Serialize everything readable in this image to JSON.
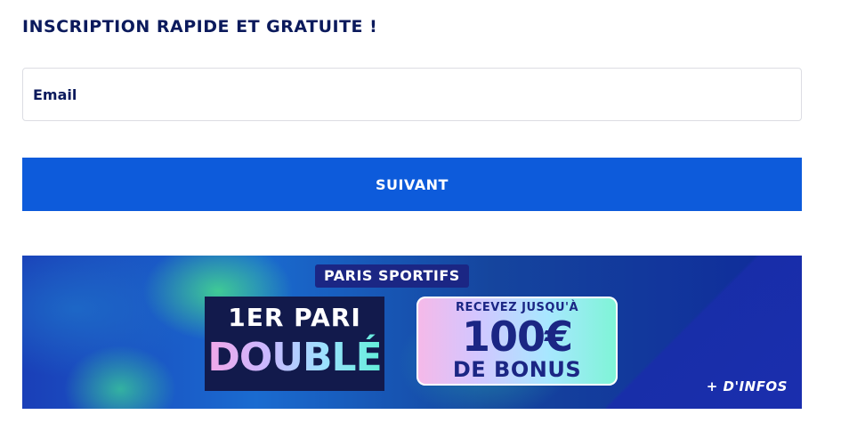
{
  "form": {
    "title": "INSCRIPTION RAPIDE ET GRATUITE !",
    "email_placeholder": "Email",
    "email_value": "",
    "next_label": "SUIVANT"
  },
  "colors": {
    "primary_button": "#0d5bdb",
    "title_text": "#0b1a5c"
  },
  "promo": {
    "badge": "PARIS SPORTIFS",
    "offer_line1": "1ER PARI",
    "offer_line2": "DOUBLÉ",
    "bonus_top": "RECEVEZ JUSQU'À",
    "bonus_amount": "100€",
    "bonus_bottom": "DE BONUS",
    "more_info": "+ D'INFOS"
  }
}
